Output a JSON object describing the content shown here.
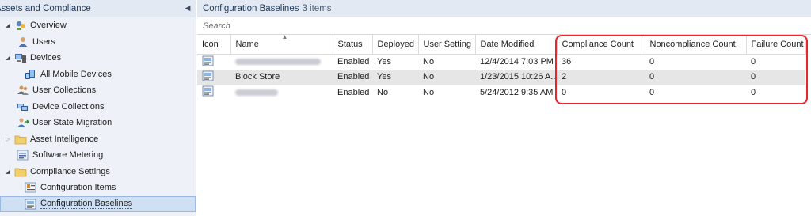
{
  "nav": {
    "title": "Assets and Compliance",
    "items": [
      {
        "label": "Overview",
        "icon": "overview-icon"
      },
      {
        "label": "Users",
        "icon": "users-icon"
      },
      {
        "label": "Devices",
        "icon": "devices-icon"
      },
      {
        "label": "All Mobile Devices",
        "icon": "mobile-devices-icon"
      },
      {
        "label": "User Collections",
        "icon": "user-collections-icon"
      },
      {
        "label": "Device Collections",
        "icon": "device-collections-icon"
      },
      {
        "label": "User State Migration",
        "icon": "user-state-migration-icon"
      },
      {
        "label": "Asset Intelligence",
        "icon": "folder-icon"
      },
      {
        "label": "Software Metering",
        "icon": "software-metering-icon"
      },
      {
        "label": "Compliance Settings",
        "icon": "folder-icon"
      },
      {
        "label": "Configuration Items",
        "icon": "configuration-items-icon"
      },
      {
        "label": "Configuration Baselines",
        "icon": "configuration-baselines-icon"
      }
    ]
  },
  "content": {
    "title": "Configuration Baselines",
    "count": "3 items",
    "search_placeholder": "Search",
    "columns": [
      "Icon",
      "Name",
      "Status",
      "Deployed",
      "User Setting",
      "Date Modified",
      "Compliance Count",
      "Noncompliance Count",
      "Failure Count"
    ],
    "rows": [
      {
        "name": "",
        "status": "Enabled",
        "deployed": "Yes",
        "user_setting": "No",
        "date_modified": "12/4/2014 7:03 PM",
        "compliance": "36",
        "noncompliance": "0",
        "failure": "0"
      },
      {
        "name": "Block Store",
        "status": "Enabled",
        "deployed": "Yes",
        "user_setting": "No",
        "date_modified": "1/23/2015 10:26 A...",
        "compliance": "2",
        "noncompliance": "0",
        "failure": "0"
      },
      {
        "name": "",
        "status": "Enabled",
        "deployed": "No",
        "user_setting": "No",
        "date_modified": "5/24/2012 9:35 AM",
        "compliance": "0",
        "noncompliance": "0",
        "failure": "0"
      }
    ]
  },
  "colors": {
    "highlight": "#e8262d",
    "header_text": "#1e395b",
    "nav_background": "#eef2f8"
  }
}
